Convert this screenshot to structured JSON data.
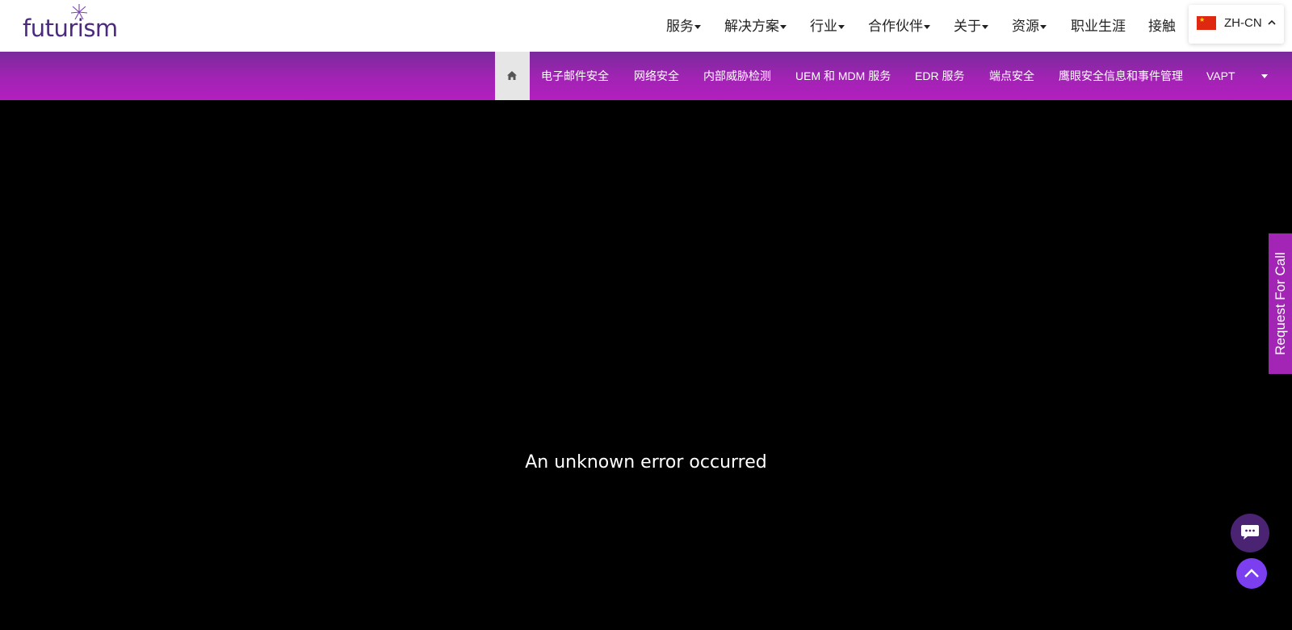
{
  "brand": {
    "logo_text": "futurism"
  },
  "main_nav": [
    {
      "label": "服务",
      "has_dropdown": true
    },
    {
      "label": "解决方案",
      "has_dropdown": true
    },
    {
      "label": "行业",
      "has_dropdown": true
    },
    {
      "label": "合作伙伴",
      "has_dropdown": true
    },
    {
      "label": "关于",
      "has_dropdown": true
    },
    {
      "label": "资源",
      "has_dropdown": true
    },
    {
      "label": "职业生涯",
      "has_dropdown": false
    },
    {
      "label": "接触",
      "has_dropdown": false
    }
  ],
  "language": {
    "code": "ZH-CN",
    "flag": "china-flag-icon"
  },
  "sub_nav": {
    "home_icon": "home-icon",
    "items": [
      "电子邮件安全",
      "网络安全",
      "内部威胁检测",
      "UEM 和 MDM 服务",
      "EDR 服务",
      "端点安全",
      "鹰眼安全信息和事件管理",
      "VAPT"
    ]
  },
  "main": {
    "error_message": "An unknown error occurred"
  },
  "side_tab": {
    "label": "Request For Call"
  },
  "floating": {
    "chat_icon": "chat-icon",
    "scroll_top_icon": "chevron-up-icon"
  },
  "colors": {
    "brand_purple": "#4b2a7f",
    "subnav_purple": "#a223b4",
    "scroll_top": "#7b3ff0"
  }
}
